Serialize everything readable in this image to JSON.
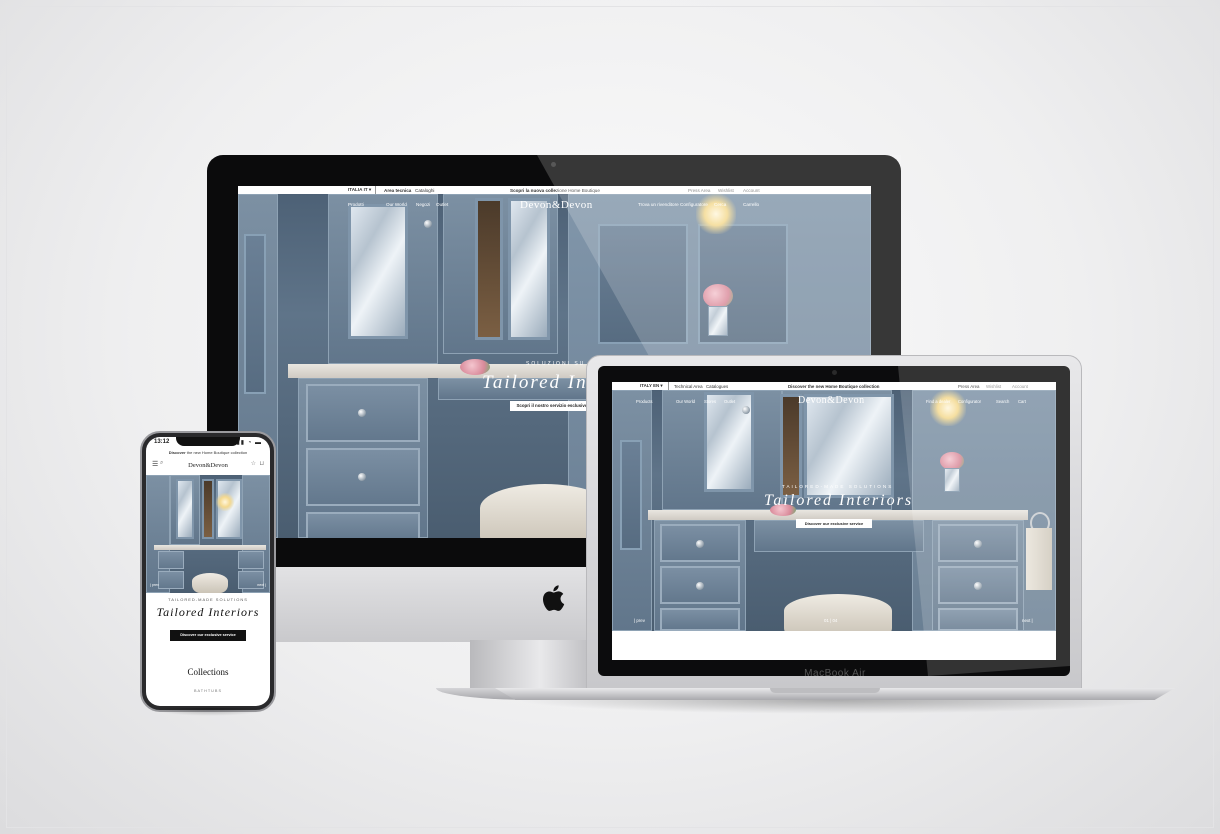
{
  "imac_site": {
    "country_selector": "ITALIA  IT ▾",
    "technical_area": "Area tecnica",
    "catalogues": "Cataloghi",
    "announcement_bold": "Scopri la nuova colle",
    "announcement_rest": "zione Home Boutique",
    "press_area": "Press Area",
    "wishlist": "Wishlist",
    "account": "Account",
    "nav_left": [
      "Prodotti",
      "Our World",
      "Negozi",
      "Outlet"
    ],
    "brand": "Devon&Devon",
    "nav_right": [
      "Trova un rivenditore",
      "Configuratore",
      "Cerca",
      "Carrello"
    ],
    "tagline": "Soluzioni su misura",
    "title": "Tailored Interiors",
    "cta": "Scopri il nostro servizio esclusivo"
  },
  "macbook_site": {
    "country_selector": "ITALY  EN ▾",
    "technical_area": "Technical Area",
    "catalogues": "Catalogues",
    "announcement": "Discover the new Home Boutique collection",
    "press_area": "Press Area",
    "wishlist": "Wishlist",
    "account": "Account",
    "nav_left": [
      "Products",
      "Our World",
      "Stores",
      "Outlet"
    ],
    "brand": "Devon&Devon",
    "nav_right": [
      "Find a dealer",
      "Configurator",
      "Search",
      "Cart"
    ],
    "tagline": "Tailored-made solutions",
    "title": "Tailored Interiors",
    "cta": "Discover our exclusive service",
    "prev": "| prev",
    "next": "next |",
    "pager": "01 | 04",
    "device_label": "MacBook Air"
  },
  "iphone_site": {
    "time": "13:12",
    "announcement_bold": "Discover",
    "announcement_rest": "the new Home Boutique collection",
    "brand": "Devon&Devon",
    "prev": "| prev",
    "next": "next |",
    "tagline": "Tailored-made solutions",
    "title": "Tailored Interiors",
    "cta": "Discover our exclusive service",
    "section_heading": "Collections",
    "section_sub": "BATHTUBS"
  },
  "colors": {
    "hero_blue": "#5f7489",
    "background": "#efeff0",
    "text_dark": "#222222"
  }
}
